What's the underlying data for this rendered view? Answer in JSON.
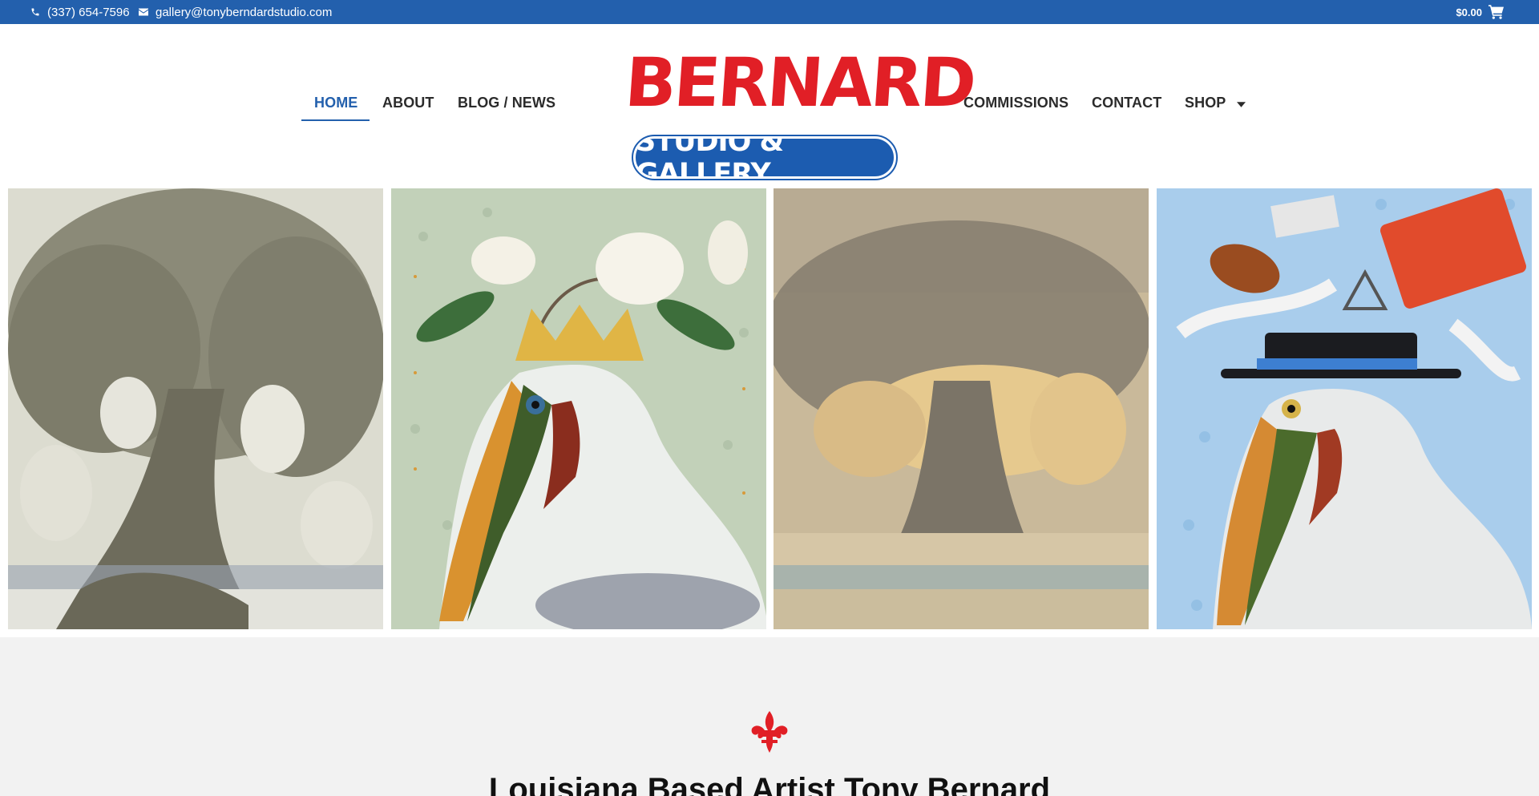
{
  "topbar": {
    "phone": "(337) 654-7596",
    "email": "gallery@tonyberndardstudio.com",
    "cart_total": "$0.00"
  },
  "nav": {
    "left": [
      {
        "label": "HOME",
        "active": true
      },
      {
        "label": "ABOUT"
      },
      {
        "label": "BLOG / NEWS"
      }
    ],
    "right": [
      {
        "label": "COMMISSIONS"
      },
      {
        "label": "CONTACT"
      },
      {
        "label": "SHOP",
        "has_dropdown": true
      }
    ]
  },
  "logo": {
    "line1": "BERNARD",
    "line2": "STUDIO & GALLERY"
  },
  "gallery": {
    "paintings": [
      {
        "subject": "live oak tree with spanish moss, grey tones"
      },
      {
        "subject": "pelican wearing gold crown with magnolias on green fleur-de-lis background"
      },
      {
        "subject": "live oak tree in golden hazy light"
      },
      {
        "subject": "pelican with black hat, fiddle, accordion and triangle on blue background"
      }
    ]
  },
  "intro": {
    "heading": "Louisiana Based Artist Tony Bernard"
  },
  "colors": {
    "brand_blue": "#2360ad",
    "logo_red": "#e11f26",
    "section_bg": "#f2f2f2"
  },
  "icons": [
    "phone-icon",
    "envelope-icon",
    "cart-icon",
    "chevron-down-icon",
    "fleur-de-lis-icon"
  ]
}
